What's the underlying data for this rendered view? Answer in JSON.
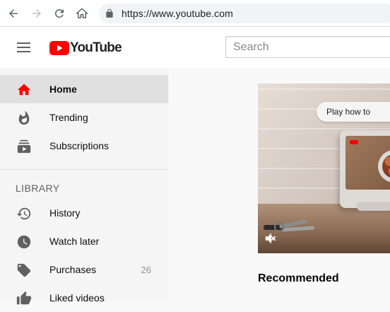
{
  "browser": {
    "url": "https://www.youtube.com",
    "icons": [
      "back-icon",
      "forward-icon",
      "reload-icon",
      "home-icon",
      "lock-icon"
    ]
  },
  "masthead": {
    "logo_text": "YouTube",
    "search_placeholder": "Search",
    "brand_color": "#ff0000"
  },
  "sidebar": {
    "items": [
      {
        "label": "Home",
        "icon": "home-icon",
        "active": true
      },
      {
        "label": "Trending",
        "icon": "flame-icon",
        "active": false
      },
      {
        "label": "Subscriptions",
        "icon": "subscriptions-icon",
        "active": false
      }
    ],
    "library_title": "LIBRARY",
    "library_items": [
      {
        "label": "History",
        "icon": "history-icon"
      },
      {
        "label": "Watch later",
        "icon": "clock-icon"
      },
      {
        "label": "Purchases",
        "icon": "tag-icon",
        "count": "26"
      },
      {
        "label": "Liked videos",
        "icon": "thumbs-up-icon"
      }
    ]
  },
  "main": {
    "hero_caption": "Play how to",
    "section_heading": "Recommended"
  }
}
